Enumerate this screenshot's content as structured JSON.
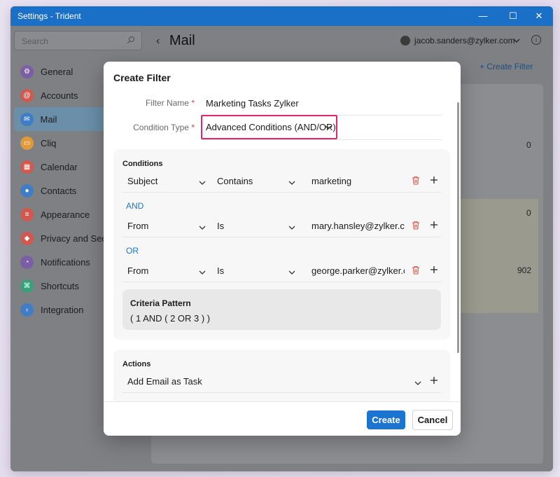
{
  "window": {
    "title": "Settings - Trident",
    "minimize_glyph": "—",
    "maximize_glyph": "☐",
    "close_glyph": "✕"
  },
  "sidebar": {
    "search_placeholder": "Search",
    "items": [
      {
        "label": "General",
        "icon": "gear-icon",
        "color": "#7b5ea7"
      },
      {
        "label": "Accounts",
        "icon": "at-icon",
        "color": "#d2574c"
      },
      {
        "label": "Mail",
        "icon": "mail-icon",
        "color": "#3f7ec7"
      },
      {
        "label": "Cliq",
        "icon": "chat-icon",
        "color": "#e09a3b"
      },
      {
        "label": "Calendar",
        "icon": "calendar-icon",
        "color": "#d2574c"
      },
      {
        "label": "Contacts",
        "icon": "contacts-icon",
        "color": "#3f7ec7"
      },
      {
        "label": "Appearance",
        "icon": "sliders-icon",
        "color": "#d2574c"
      },
      {
        "label": "Privacy and Security",
        "icon": "shield-icon",
        "color": "#d2574c"
      },
      {
        "label": "Notifications",
        "icon": "bell-icon",
        "color": "#7b5ea7"
      },
      {
        "label": "Shortcuts",
        "icon": "command-icon",
        "color": "#3aa07a"
      },
      {
        "label": "Integration",
        "icon": "terminal-icon",
        "color": "#3f7ec7"
      }
    ],
    "active_index": 2
  },
  "header": {
    "back_glyph": "‹",
    "title": "Mail",
    "account": "jacob.sanders@zylker.com",
    "create_filter": "+ Create Filter",
    "info_glyph": "i"
  },
  "background_values": [
    "0",
    "0",
    "902"
  ],
  "dialog": {
    "title": "Create Filter",
    "filter_name_label": "Filter Name",
    "filter_name_value": "Marketing Tasks Zylker",
    "condition_type_label": "Condition Type",
    "condition_type_value": "Advanced Conditions (AND/OR)",
    "required_mark": "*",
    "conditions": {
      "title": "Conditions",
      "rows": [
        {
          "field": "Subject",
          "operator": "Contains",
          "value": "marketing"
        },
        {
          "connector": "AND",
          "field": "From",
          "operator": "Is",
          "value": "mary.hansley@zylker.con"
        },
        {
          "connector": "OR",
          "field": "From",
          "operator": "Is",
          "value": "george.parker@zylker.co"
        }
      ]
    },
    "criteria_pattern": {
      "title": "Criteria Pattern",
      "value": "( 1 AND ( 2 OR 3 ) )"
    },
    "actions": {
      "title": "Actions",
      "first_action": "Add Email as Task"
    },
    "buttons": {
      "create": "Create",
      "cancel": "Cancel"
    }
  }
}
